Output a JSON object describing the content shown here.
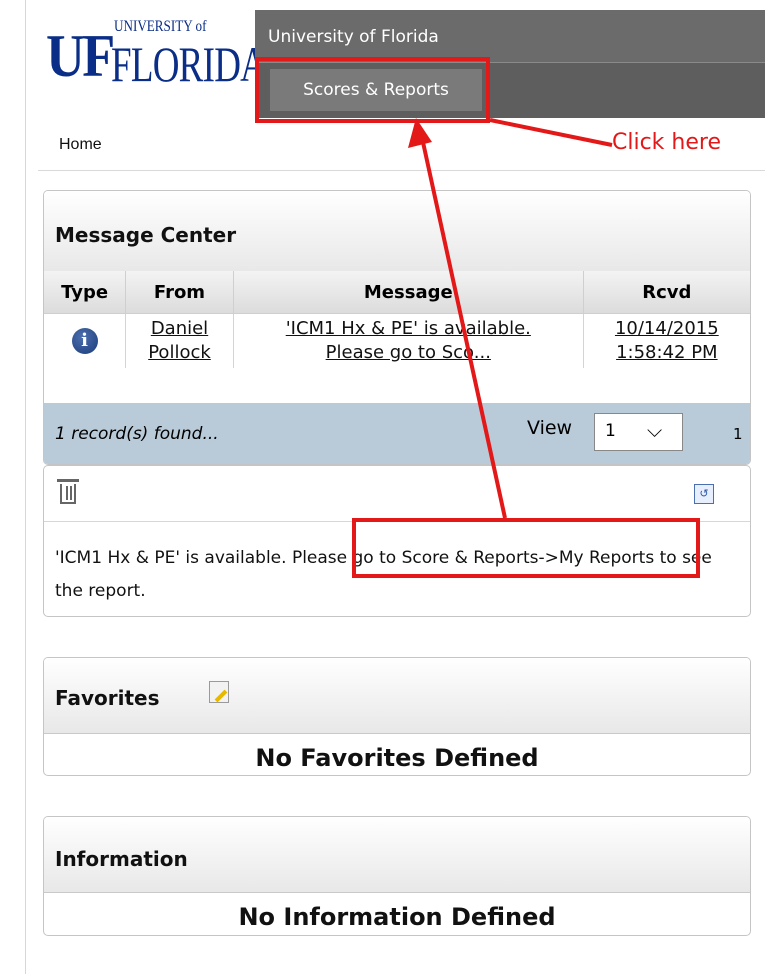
{
  "header": {
    "logo_uf": "UF",
    "logo_university": "UNIVERSITY of",
    "logo_florida": "FLORIDA",
    "site_title": "University of Florida",
    "nav_tab": "Scores & Reports",
    "breadcrumb": "Home"
  },
  "message_center": {
    "title": "Message Center",
    "columns": [
      "Type",
      "From",
      "Message",
      "Rcvd"
    ],
    "row": {
      "from_line1": "Daniel",
      "from_line2": "Pollock",
      "message_line1": "'ICM1 Hx & PE' is available.",
      "message_line2": "Please go to Sco...",
      "rcvd_line1": "10/14/2015",
      "rcvd_line2": "1:58:42 PM"
    },
    "records_found": "1 record(s) found...",
    "view_label": "View",
    "view_value": "1",
    "page_total": "1"
  },
  "message_detail": {
    "text": "'ICM1 Hx & PE' is available. Please go to Score & Reports->My Reports to see the report."
  },
  "favorites": {
    "title": "Favorites",
    "empty": "No Favorites Defined"
  },
  "information": {
    "title": "Information",
    "empty": "No Information Defined"
  },
  "annotation": {
    "click_here": "Click here",
    "color": "#e31818"
  }
}
